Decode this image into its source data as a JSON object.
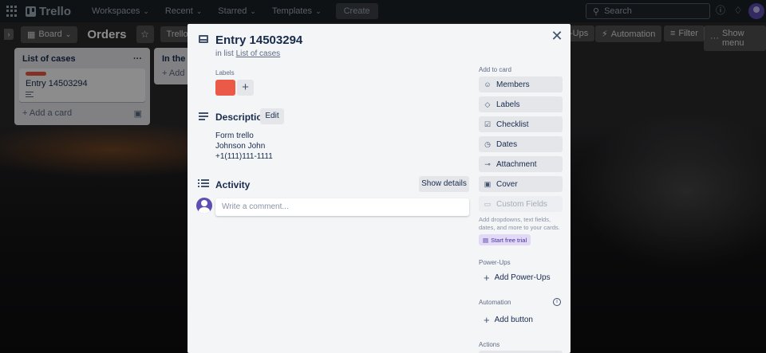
{
  "topnav": {
    "logo": "Trello",
    "menus": [
      "Workspaces",
      "Recent",
      "Starred",
      "Templates"
    ],
    "create": "Create",
    "search_placeholder": "Search"
  },
  "board": {
    "view_button": "Board",
    "title": "Orders",
    "workspace": "Trello work site",
    "right_buttons": [
      "Power-Ups",
      "Automation",
      "Filter",
      "Show menu"
    ],
    "right_buttons_visible": [
      "-Ups",
      "Automation",
      "Filter",
      "Show menu"
    ]
  },
  "lists": [
    {
      "title": "List of cases",
      "card_title": "Entry 14503294",
      "add_card": "Add a card"
    },
    {
      "title": "In the pr",
      "add": "Add"
    }
  ],
  "modal": {
    "title": "Entry 14503294",
    "in_list_prefix": "in list",
    "in_list_link": "List of cases",
    "labels_heading": "Labels",
    "label_color": "#eb5a46",
    "description_heading": "Description",
    "edit_button": "Edit",
    "description_lines": [
      "Form trello",
      "Johnson John",
      "+1(111)111-1111"
    ],
    "activity_heading": "Activity",
    "show_details": "Show details",
    "comment_placeholder": "Write a comment..."
  },
  "sidebar": {
    "add_to_card": "Add to card",
    "buttons": [
      {
        "label": "Members",
        "icon": "person-icon"
      },
      {
        "label": "Labels",
        "icon": "tag-icon"
      },
      {
        "label": "Checklist",
        "icon": "checklist-icon"
      },
      {
        "label": "Dates",
        "icon": "clock-icon"
      },
      {
        "label": "Attachment",
        "icon": "paperclip-icon"
      },
      {
        "label": "Cover",
        "icon": "cover-icon"
      },
      {
        "label": "Custom Fields",
        "icon": "custom-fields-icon"
      }
    ],
    "custom_fields_note": "Add dropdowns, text fields, dates, and more to your cards.",
    "free_trial": "Start free trial",
    "powerups_heading": "Power-Ups",
    "add_powerups": "Add Power-Ups",
    "automation_heading": "Automation",
    "add_button": "Add button",
    "actions_heading": "Actions"
  }
}
